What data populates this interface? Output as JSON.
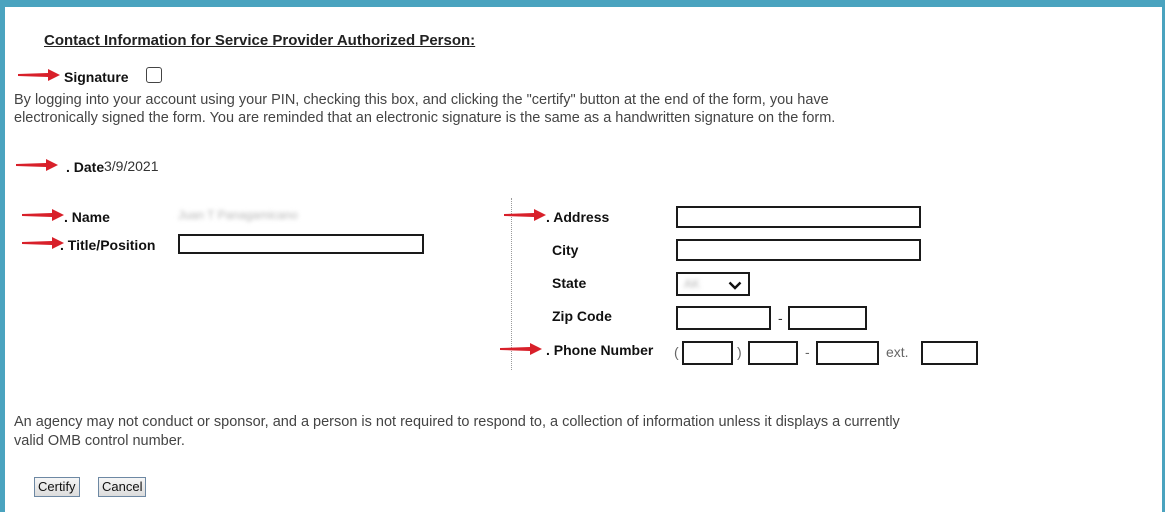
{
  "heading": "Contact Information for Service Provider Authorized Person:",
  "signature": {
    "label": "Signature",
    "text_line1": "By logging into your account using your PIN, checking this box, and clicking the \"certify\" button at the end of the form, you have",
    "text_line2": "electronically signed the form. You are reminded that an electronic signature is the same as a handwritten signature on the form.",
    "checked": false
  },
  "date": {
    "label": "Date",
    "value": "3/9/2021"
  },
  "name": {
    "label": "Name",
    "value": "Juan T Panagamicano"
  },
  "title_position": {
    "label": "Title/Position",
    "value": ""
  },
  "address": {
    "label": "Address",
    "value": ""
  },
  "city": {
    "label": "City",
    "value": ""
  },
  "state": {
    "label": "State",
    "selected": "AK"
  },
  "zip": {
    "label": "Zip Code",
    "dash": "-",
    "value": "",
    "ext_value": ""
  },
  "phone": {
    "label": "Phone Number",
    "open_paren": "(",
    "close_paren": ")",
    "dash": "-",
    "ext_label": "ext."
  },
  "omb": {
    "line1": "An agency may not conduct or sponsor, and a person is not required to respond to, a collection of information unless it displays a currently",
    "line2": "valid OMB control number."
  },
  "buttons": {
    "certify": "Certify",
    "cancel": "Cancel"
  },
  "colors": {
    "frame": "#4aa3bf",
    "arrow": "#d8202a"
  }
}
